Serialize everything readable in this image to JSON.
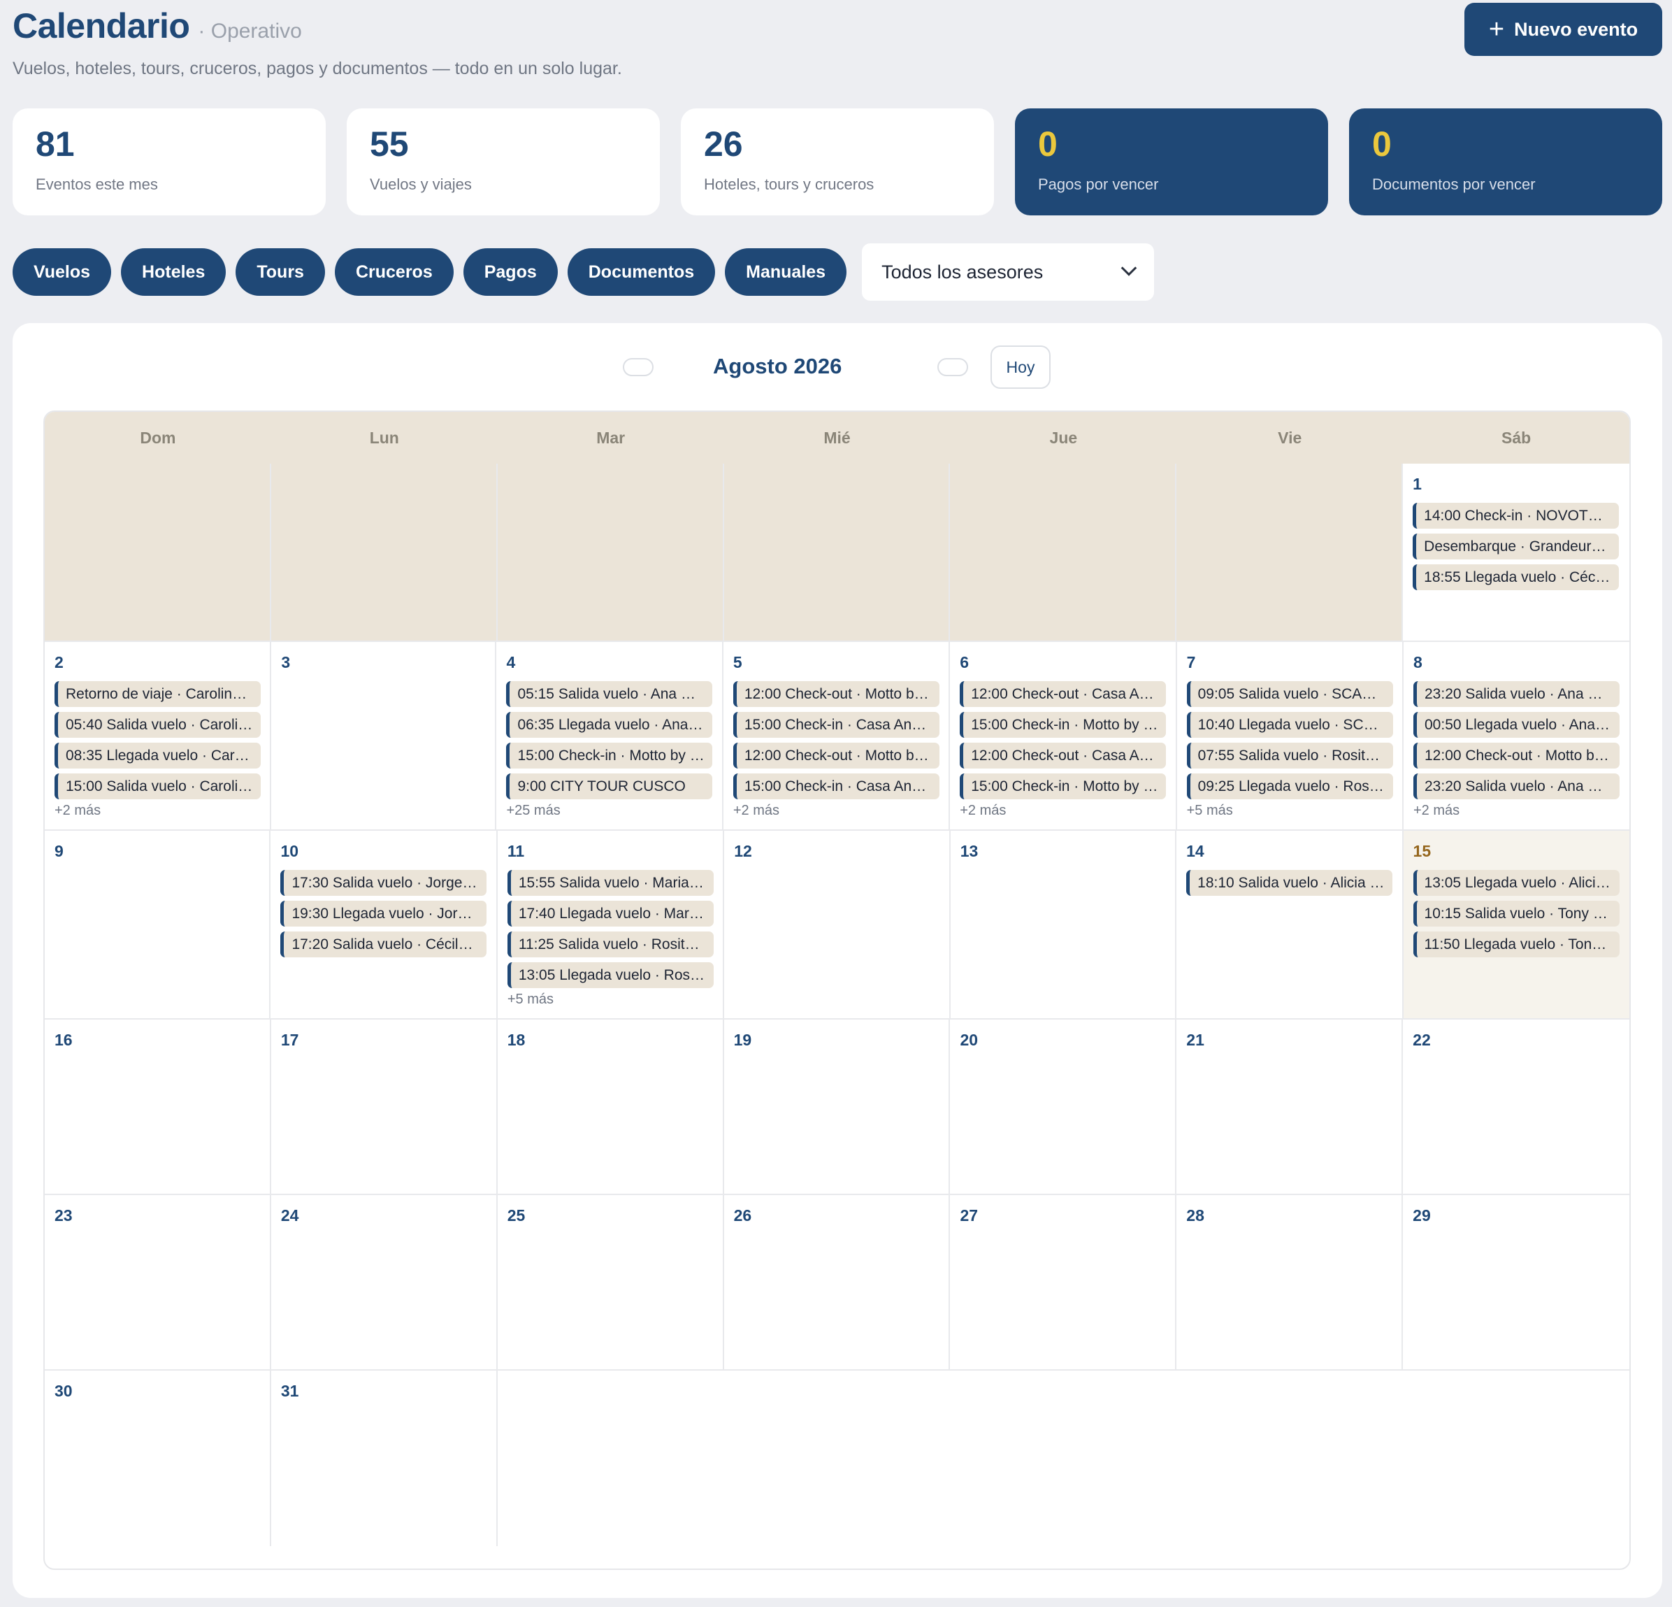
{
  "header": {
    "title": "Calendario",
    "section": "· Operativo",
    "subtitle": "Vuelos, hoteles, tours, cruceros, pagos y documentos — todo en un solo lugar.",
    "new_button": "Nuevo evento",
    "new_button_icon": "plus-icon"
  },
  "stats": [
    {
      "value": "81",
      "label": "Eventos este mes"
    },
    {
      "value": "55",
      "label": "Vuelos y viajes"
    },
    {
      "value": "26",
      "label": "Hoteles, tours y cruceros"
    },
    {
      "value": "0",
      "label": "Pagos por vencer"
    },
    {
      "value": "0",
      "label": "Documentos por vencer"
    }
  ],
  "filters": [
    "Vuelos",
    "Hoteles",
    "Tours",
    "Cruceros",
    "Pagos",
    "Documentos",
    "Manuales"
  ],
  "advisor_select": {
    "value": "Todos los asesores",
    "icon": "chevron-down-icon"
  },
  "calendar": {
    "month_label": "Agosto 2026",
    "today_button": "Hoy",
    "weekdays": [
      "Dom",
      "Lun",
      "Mar",
      "Mié",
      "Jue",
      "Vie",
      "Sáb"
    ],
    "weeks": [
      [
        {
          "empty": true
        },
        {
          "empty": true
        },
        {
          "empty": true
        },
        {
          "empty": true
        },
        {
          "empty": true
        },
        {
          "empty": true
        },
        {
          "day": "1",
          "events": [
            "14:00 Check-in · NOVOTEL …",
            "Desembarque · Grandeur…",
            "18:55 Llegada vuelo · Céci…"
          ]
        }
      ],
      [
        {
          "day": "2",
          "events": [
            "Retorno de viaje · Carolin…",
            "05:40 Salida vuelo · Caroli…",
            "08:35 Llegada vuelo · Car…",
            "15:00 Salida vuelo · Caroli…"
          ],
          "more": "+2 más"
        },
        {
          "day": "3",
          "events": []
        },
        {
          "day": "4",
          "events": [
            "05:15 Salida vuelo · Ana C…",
            "06:35 Llegada vuelo · Ana…",
            "15:00 Check-in · Motto by …",
            "9:00 CITY TOUR CUSCO"
          ],
          "more": "+25 más"
        },
        {
          "day": "5",
          "events": [
            "12:00 Check-out · Motto b…",
            "15:00 Check-in · Casa An…",
            "12:00 Check-out · Motto b…",
            "15:00 Check-in · Casa An…"
          ],
          "more": "+2 más"
        },
        {
          "day": "6",
          "events": [
            "12:00 Check-out · Casa A…",
            "15:00 Check-in · Motto by …",
            "12:00 Check-out · Casa A…",
            "15:00 Check-in · Motto by …"
          ],
          "more": "+2 más"
        },
        {
          "day": "7",
          "events": [
            "09:05 Salida vuelo · SCAR…",
            "10:40 Llegada vuelo · SCA…",
            "07:55 Salida vuelo · Rosita…",
            "09:25 Llegada vuelo · Rosi…"
          ],
          "more": "+5 más"
        },
        {
          "day": "8",
          "events": [
            "23:20 Salida vuelo · Ana C…",
            "00:50 Llegada vuelo · Ana…",
            "12:00 Check-out · Motto b…",
            "23:20 Salida vuelo · Ana C…"
          ],
          "more": "+2 más"
        }
      ],
      [
        {
          "day": "9",
          "events": []
        },
        {
          "day": "10",
          "events": [
            "17:30 Salida vuelo · Jorge …",
            "19:30 Llegada vuelo · Jorg…",
            "17:20 Salida vuelo · Cécile …"
          ]
        },
        {
          "day": "11",
          "events": [
            "15:55 Salida vuelo · Maria …",
            "17:40 Llegada vuelo · Mari…",
            "11:25 Salida vuelo · Rosita …",
            "13:05 Llegada vuelo · Rosit…"
          ],
          "more": "+5 más"
        },
        {
          "day": "12",
          "events": []
        },
        {
          "day": "13",
          "events": []
        },
        {
          "day": "14",
          "events": [
            "18:10 Salida vuelo · Alicia S…"
          ]
        },
        {
          "day": "15",
          "today": true,
          "events": [
            "13:05 Llegada vuelo · Alici…",
            "10:15 Salida vuelo · Tony P…",
            "11:50 Llegada vuelo · Tony …"
          ]
        }
      ],
      [
        {
          "day": "16",
          "events": []
        },
        {
          "day": "17",
          "events": []
        },
        {
          "day": "18",
          "events": []
        },
        {
          "day": "19",
          "events": []
        },
        {
          "day": "20",
          "events": []
        },
        {
          "day": "21",
          "events": []
        },
        {
          "day": "22",
          "events": []
        }
      ],
      [
        {
          "day": "23",
          "events": []
        },
        {
          "day": "24",
          "events": []
        },
        {
          "day": "25",
          "events": []
        },
        {
          "day": "26",
          "events": []
        },
        {
          "day": "27",
          "events": []
        },
        {
          "day": "28",
          "events": []
        },
        {
          "day": "29",
          "events": []
        }
      ],
      [
        {
          "day": "30",
          "events": []
        },
        {
          "day": "31",
          "events": []
        },
        {
          "blank": true
        },
        {
          "blank": true
        },
        {
          "blank": true
        },
        {
          "blank": true
        },
        {
          "blank": true
        }
      ]
    ]
  },
  "colors": {
    "primary": "#1f4876",
    "accent_yellow": "#ebc83d",
    "event_bg": "#ebe4d8",
    "today_number": "#95661d",
    "page_bg": "#edeef2"
  }
}
